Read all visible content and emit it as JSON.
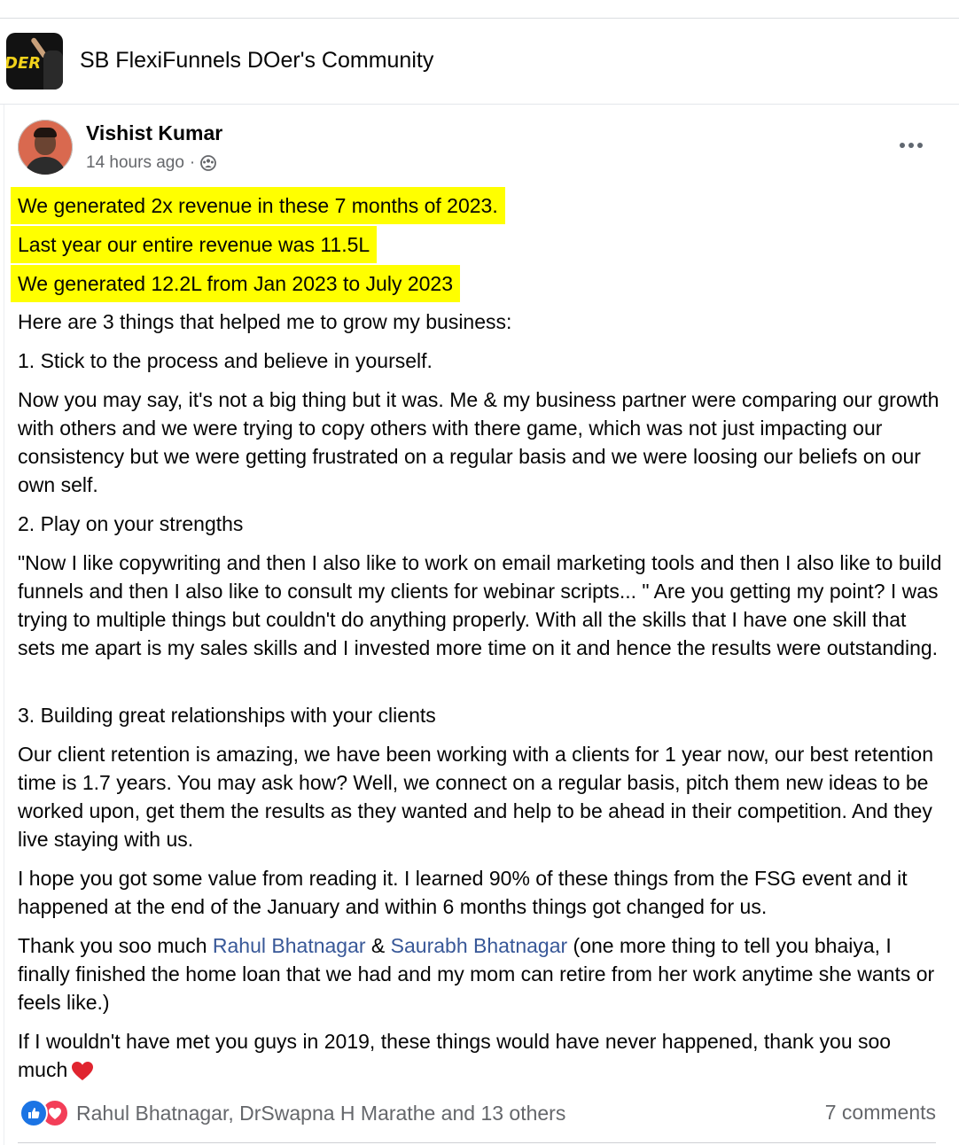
{
  "group": {
    "logo_text": "DER",
    "title": "SB FlexiFunnels DOer's Community"
  },
  "post": {
    "author": "Vishist Kumar",
    "time": "14 hours ago",
    "separator": "·",
    "audience_icon": "group-audience-icon",
    "highlights": [
      "We generated 2x revenue in these 7 months of 2023.",
      "Last year our entire revenue was 11.5L",
      "We generated 12.2L from Jan 2023 to July 2023"
    ],
    "paragraphs": [
      "Here are 3 things that helped me to grow my business:",
      "1. Stick to the process and believe in yourself.",
      "Now you may say, it's not a big thing but it was. Me & my business partner were comparing our growth with others and we were trying to copy others with there game, which was not just impacting our consistency but we were getting frustrated on a regular basis and we were loosing our beliefs on our own self.",
      "2. Play on your strengths",
      "\"Now I like copywriting and then I also like to work on email marketing tools and then I also like to build funnels and then I also like to consult my clients for webinar scripts... \" Are you getting my point? I was trying to multiple things but couldn't do anything properly. With all the skills that I have one skill that sets me apart is my sales skills and I invested more time on it and hence the results were outstanding.",
      "3. Building great relationships with your clients",
      "Our client retention is amazing, we have been working with a clients for 1 year now, our best retention time is 1.7 years. You may ask how? Well, we connect on a regular basis, pitch them new ideas to be worked upon, get them the results as they wanted and help to be ahead in their competition. And they live staying with us.",
      "I hope you got some value from reading it. I learned 90% of these things from the FSG event and it happened at the end of the January and within 6 months things got changed for us."
    ],
    "thanks": {
      "prefix": "Thank you soo much ",
      "mention1": "Rahul Bhatnagar",
      "amp": " & ",
      "mention2": "Saurabh Bhatnagar",
      "suffix": " (one more thing to tell you bhaiya, I finally finished the home loan that we had and my mom can retire from her work anytime she wants or feels like.)"
    },
    "closing": "If I wouldn't have met you guys in 2019, these things would have never happened, thank you soo much",
    "reactions_text": "Rahul Bhatnagar, DrSwapna H Marathe and 13 others",
    "comments_text": "7 comments"
  },
  "colors": {
    "highlight": "#ffff00",
    "link": "#385898",
    "like": "#1b74e4",
    "love": "#f33e58",
    "secondary_text": "#65676b"
  }
}
